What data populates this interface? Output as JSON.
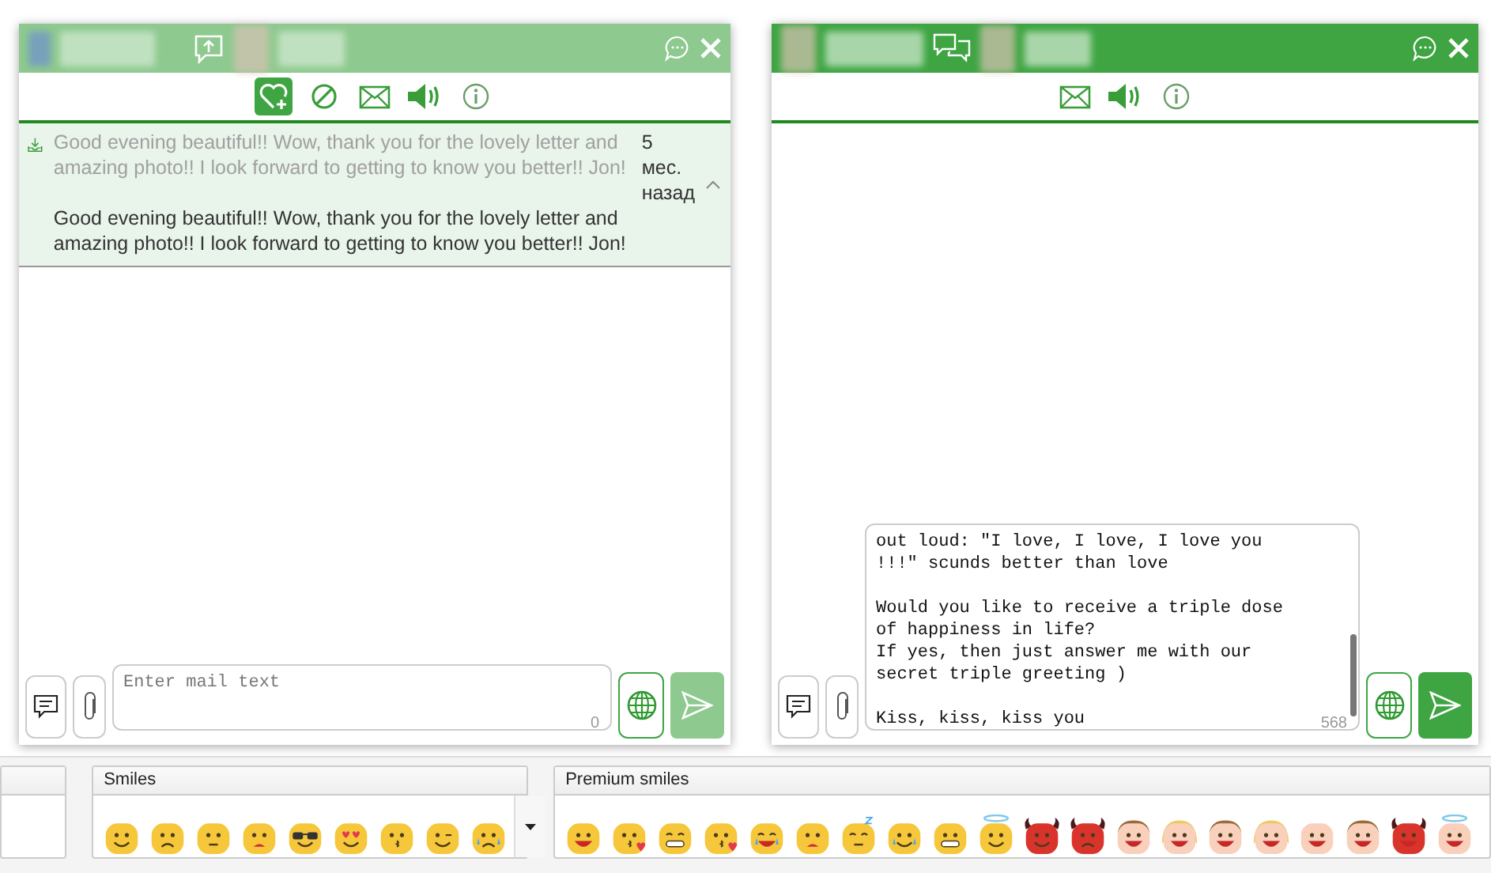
{
  "windows": [
    {
      "tools": [
        {
          "kind": "favorite",
          "selected": true
        },
        {
          "kind": "block",
          "selected": false
        },
        {
          "kind": "mail",
          "selected": false
        },
        {
          "kind": "sound",
          "selected": false
        },
        {
          "kind": "info",
          "selected": false
        }
      ],
      "messages": [
        {
          "preview": "Good evening beautiful!! Wow, thank you for the lovely letter and amazing photo!! I look forward to getting to know you better!! Jon!",
          "time": "5 мес. назад",
          "expanded": true,
          "text": "Good evening beautiful!! Wow, thank you for the lovely letter and amazing photo!! I look forward to getting to know you better!! Jon!"
        }
      ],
      "composer": {
        "placeholder": "Enter mail text",
        "counter": "0",
        "send_disabled": true
      }
    },
    {
      "tools": [
        {
          "kind": "mail",
          "selected": false
        },
        {
          "kind": "sound",
          "selected": false
        },
        {
          "kind": "info",
          "selected": false
        }
      ],
      "composer": {
        "value": "out loud: \"I love, I love, I love you\n!!!\" scunds better than love\n\nWould you like to receive a triple dose\nof happiness in life?\nIf yes, then just answer me with our\nsecret triple greeting )\n\nKiss, kiss, kiss you",
        "counter": "568",
        "send_disabled": false
      }
    }
  ],
  "panels": [
    {
      "kind": "blank"
    },
    {
      "kind": "smiles",
      "title": "Smiles",
      "dropdown": true
    },
    {
      "kind": "premium",
      "title": "Premium smiles"
    }
  ]
}
